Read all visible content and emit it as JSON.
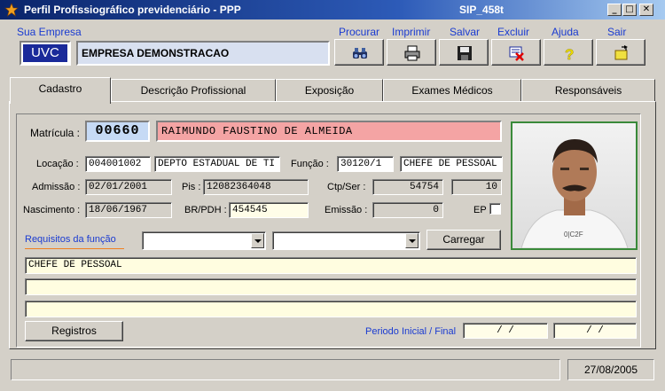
{
  "window": {
    "title": "Perfil Profissiográfico previdenciário - PPP",
    "code": "SIP_458t",
    "controls": {
      "minimize": "_",
      "maximize": "□",
      "close": "✕"
    }
  },
  "header": {
    "empresa_label": "Sua Empresa",
    "empresa_code": "UVC",
    "empresa_name": "EMPRESA DEMONSTRACAO"
  },
  "toolbar": [
    {
      "label": "Procurar",
      "icon": "binoculars-icon"
    },
    {
      "label": "Imprimir",
      "icon": "printer-icon"
    },
    {
      "label": "Salvar",
      "icon": "floppy-disk-icon"
    },
    {
      "label": "Excluir",
      "icon": "delete-icon"
    },
    {
      "label": "Ajuda",
      "icon": "question-icon"
    },
    {
      "label": "Sair",
      "icon": "exit-door-icon"
    }
  ],
  "tabs": [
    {
      "label": "Cadastro",
      "active": true
    },
    {
      "label": "Descrição Profissional",
      "active": false
    },
    {
      "label": "Exposição",
      "active": false
    },
    {
      "label": "Exames Médicos",
      "active": false
    },
    {
      "label": "Responsáveis",
      "active": false
    }
  ],
  "form": {
    "matricula_label": "Matrícula :",
    "matricula": "00660",
    "nome": "RAIMUNDO FAUSTINO DE ALMEIDA",
    "locacao_label": "Locação :",
    "locacao_code": "004001002",
    "locacao_desc": "DEPTO ESTADUAL DE TI",
    "funcao_label": "Função :",
    "funcao_code": "30120/1",
    "funcao_desc": "CHEFE DE PESSOAL",
    "admissao_label": "Admissão :",
    "admissao": "02/01/2001",
    "pis_label": "Pis :",
    "pis": "12082364048",
    "ctps_label": "Ctp/Ser :",
    "ctps_num": "54754",
    "ctps_serie": "10",
    "nascimento_label": "Nascimento :",
    "nascimento": "18/06/1967",
    "brpdh_label": "BR/PDH :",
    "brpdh": "454545",
    "emissao_label": "Emissão :",
    "emissao": "0",
    "ep_label": "EP",
    "ep_checked": false,
    "requisitos_label": "Requisitos da função",
    "requisito_select_1": "",
    "requisito_select_2": "",
    "carregar_label": "Carregar",
    "lines": [
      "CHEFE DE PESSOAL",
      "",
      ""
    ],
    "registros_label": "Registros",
    "periodo_label": "Periodo Inicial / Final",
    "periodo_inicial": "  /  /",
    "periodo_final": "/  /"
  },
  "statusbar": {
    "message": "",
    "date": "27/08/2005"
  },
  "colors": {
    "title_start": "#0a246a",
    "accent_blue": "#1a3bd1",
    "name_bg": "#f4a4a4",
    "matricula_bg": "#c6daf5",
    "photo_border": "#3a8a3a"
  }
}
